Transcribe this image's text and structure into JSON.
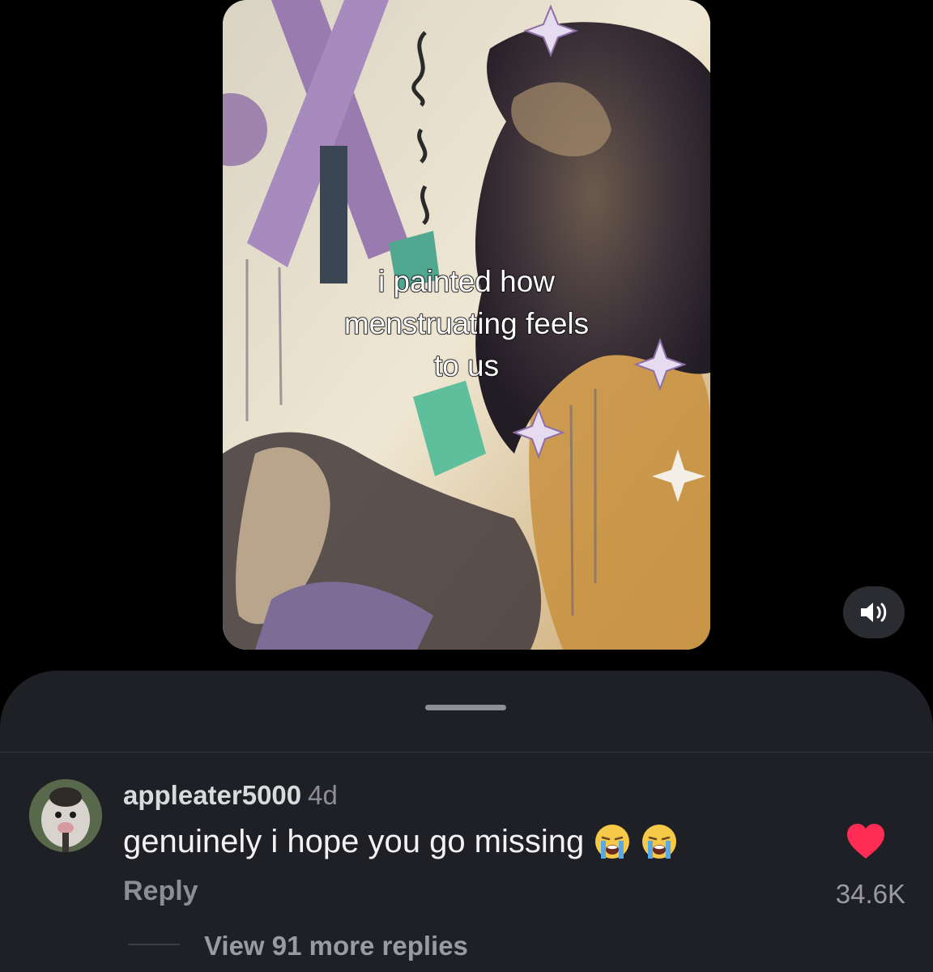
{
  "video": {
    "caption_lines": [
      "i painted how",
      "menstruating feels",
      "to us"
    ]
  },
  "controls": {
    "volume_icon": "speaker-on-icon"
  },
  "comment": {
    "username": "appleater5000",
    "time": "4d",
    "text": "genuinely i hope you go missing",
    "emojis": [
      "loudly-crying-face",
      "loudly-crying-face"
    ],
    "reply_label": "Reply",
    "like_icon": "heart-icon",
    "like_count": "34.6K",
    "like_color": "#fe2c55",
    "view_more_label": "View 91 more replies"
  }
}
